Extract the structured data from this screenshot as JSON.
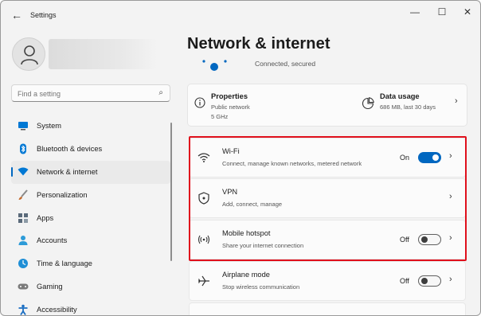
{
  "window": {
    "app_title": "Settings",
    "back_icon": "arrow-left-icon",
    "controls": {
      "minimize": "—",
      "maximize": "☐",
      "close": "✕"
    }
  },
  "sidebar": {
    "search_placeholder": "Find a setting",
    "items": [
      {
        "label": "System",
        "icon": "monitor-icon",
        "color": "#0078d4"
      },
      {
        "label": "Bluetooth & devices",
        "icon": "bluetooth-icon",
        "color": "#0078d4"
      },
      {
        "label": "Network & internet",
        "icon": "wifi-diamond-icon",
        "color": "#0078d4",
        "active": true
      },
      {
        "label": "Personalization",
        "icon": "brush-icon",
        "color": "#c46a2c"
      },
      {
        "label": "Apps",
        "icon": "apps-icon",
        "color": "#5a6a7a"
      },
      {
        "label": "Accounts",
        "icon": "person-icon",
        "color": "#2d9bd8"
      },
      {
        "label": "Time & language",
        "icon": "globe-clock-icon",
        "color": "#1f8fd6"
      },
      {
        "label": "Gaming",
        "icon": "gamepad-icon",
        "color": "#7a7a7a"
      },
      {
        "label": "Accessibility",
        "icon": "accessibility-icon",
        "color": "#1b6ec2"
      }
    ]
  },
  "main": {
    "title": "Network & internet",
    "status_text": "Connected, secured",
    "properties": {
      "title": "Properties",
      "line1": "Public network",
      "line2": "5 GHz"
    },
    "data_usage": {
      "title": "Data usage",
      "subtitle": "686 MB, last 30 days"
    },
    "rows": [
      {
        "title": "Wi-Fi",
        "subtitle": "Connect, manage known networks, metered network",
        "state": "On",
        "toggle": "on",
        "icon": "wifi-icon"
      },
      {
        "title": "VPN",
        "subtitle": "Add, connect, manage",
        "state": "",
        "toggle": "none",
        "icon": "shield-icon"
      },
      {
        "title": "Mobile hotspot",
        "subtitle": "Share your internet connection",
        "state": "Off",
        "toggle": "off",
        "icon": "hotspot-icon"
      },
      {
        "title": "Airplane mode",
        "subtitle": "Stop wireless communication",
        "state": "Off",
        "toggle": "off",
        "icon": "airplane-icon"
      }
    ],
    "highlight_color": "#e0101c",
    "accent_color": "#0067c0"
  }
}
